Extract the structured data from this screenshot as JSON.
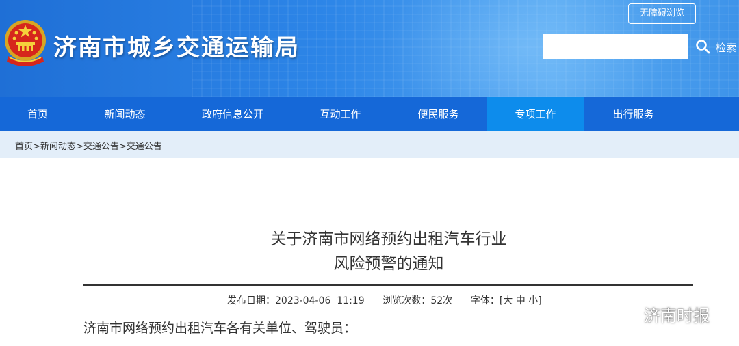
{
  "header": {
    "site_title": "济南市城乡交通运输局",
    "accessibility_label": "无障碍浏览",
    "search": {
      "placeholder": "",
      "button_label": "检索"
    },
    "emblem_icon": "national-emblem-icon",
    "colors": {
      "banner": "#2d86e8",
      "nav": "#1568d8",
      "nav_active": "#0d8cec",
      "breadcrumb_bg": "#e3eef9"
    }
  },
  "nav": {
    "items": [
      {
        "label": "首页"
      },
      {
        "label": "新闻动态"
      },
      {
        "label": "政府信息公开"
      },
      {
        "label": "互动工作"
      },
      {
        "label": "便民服务"
      },
      {
        "label": "专项工作",
        "active": true
      },
      {
        "label": "出行服务"
      }
    ]
  },
  "breadcrumb": [
    "首页",
    "新闻动态",
    "交通公告",
    "交通公告"
  ],
  "breadcrumb_separator": ">",
  "article": {
    "title_line1": "关于济南市网络预约出租汽车行业",
    "title_line2": "风险预警的通知",
    "meta": {
      "published_label": "发布日期：",
      "published_value": "2023-04-06  11:19",
      "views_label": "浏览次数：",
      "views_value": "52次",
      "font_label": "字体：",
      "font_options": "[大 中 小]"
    },
    "salutation": "济南市网络预约出租汽车各有关单位、驾驶员："
  },
  "watermark": {
    "text": "济南时报",
    "icon": "wechat-icon"
  }
}
